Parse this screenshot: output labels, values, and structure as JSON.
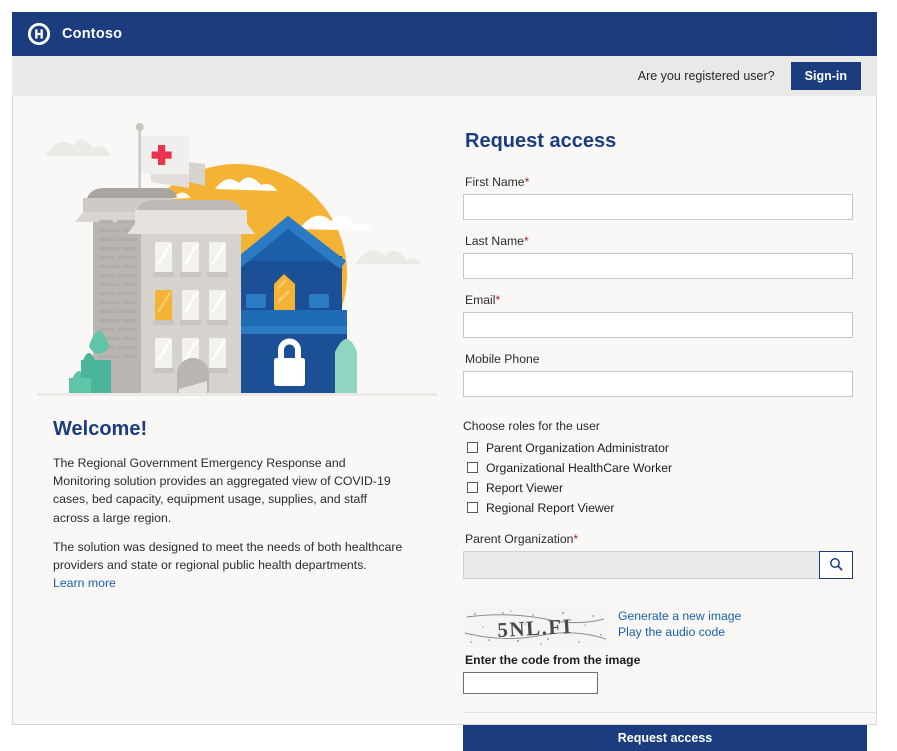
{
  "header": {
    "brand_name": "Contoso",
    "logo_icon": "hospital-h-circle-icon",
    "brand_bg": "#1b3d7f"
  },
  "signin_bar": {
    "question": "Are you registered user?",
    "signin_label": "Sign-in"
  },
  "left_panel": {
    "illustration": {
      "name": "hospital-government-building-illustration",
      "sun_color": "#f5b335",
      "building_grey": "#d6d3cf",
      "building_blue": "#1b5fa8",
      "tree_green": "#5fc4a8",
      "cross_red": "#e8344e",
      "flag_white": "#f0efed",
      "lock_icon": "white-padlock-icon",
      "cross_icon": "red-medical-cross-icon"
    },
    "welcome_title": "Welcome!",
    "paragraph_1": "The Regional Government Emergency Response and Monitoring solution provides an aggregated view of COVID-19 cases, bed capacity, equipment usage, supplies, and staff across a large region.",
    "paragraph_2": "The solution was designed to meet the needs of both healthcare providers and state or regional public health departments.",
    "learn_more_label": "Learn more"
  },
  "form": {
    "title": "Request access",
    "fields": [
      {
        "label": "First Name",
        "required": true,
        "value": "",
        "placeholder": ""
      },
      {
        "label": "Last Name",
        "required": true,
        "value": "",
        "placeholder": ""
      },
      {
        "label": "Email",
        "required": true,
        "value": "",
        "placeholder": ""
      },
      {
        "label": "Mobile Phone",
        "required": false,
        "value": "",
        "placeholder": ""
      }
    ],
    "roles_title": "Choose roles for the user",
    "roles": [
      {
        "label": "Parent Organization Administrator",
        "checked": false
      },
      {
        "label": "Organizational HealthCare Worker",
        "checked": false
      },
      {
        "label": "Report Viewer",
        "checked": false
      },
      {
        "label": "Regional Report Viewer",
        "checked": false
      }
    ],
    "parent_org": {
      "label": "Parent Organization",
      "required": true,
      "value": "",
      "search_icon": "magnifier-icon"
    },
    "captcha": {
      "code_text": "5NL.FI",
      "generate_link": "Generate a new image",
      "audio_link": "Play the audio code",
      "input_label": "Enter the code from the image",
      "input_value": ""
    },
    "submit_label": "Request access",
    "required_marker": "*"
  },
  "colors": {
    "brand_blue": "#1b3d7f",
    "link_blue": "#1b5fae",
    "required_red": "#a4262c",
    "panel_bg": "#f9f8f6",
    "bar_bg": "#e9e9e9"
  }
}
